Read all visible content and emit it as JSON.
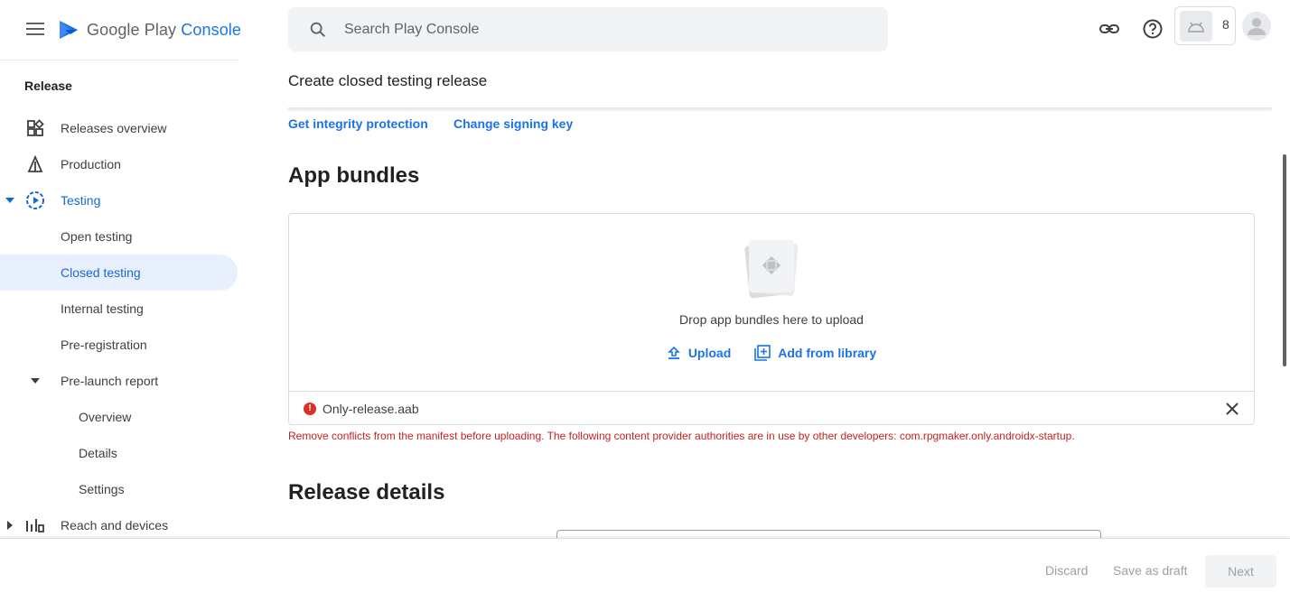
{
  "header": {
    "logo_google": "Google Play",
    "logo_console": "Console",
    "search_placeholder": "Search Play Console",
    "app_count": "8"
  },
  "sidebar": {
    "section": "Release",
    "items": [
      {
        "label": "Releases overview",
        "icon": "dashboard-icon"
      },
      {
        "label": "Production",
        "icon": "production-icon"
      },
      {
        "label": "Testing",
        "icon": "testing-icon"
      },
      {
        "label": "Open testing"
      },
      {
        "label": "Closed testing"
      },
      {
        "label": "Internal testing"
      },
      {
        "label": "Pre-registration"
      },
      {
        "label": "Pre-launch report"
      },
      {
        "label": "Overview"
      },
      {
        "label": "Details"
      },
      {
        "label": "Settings"
      },
      {
        "label": "Reach and devices",
        "icon": "bar-chart-icon"
      }
    ]
  },
  "main": {
    "title": "Create closed testing release",
    "links": [
      "Get integrity protection",
      "Change signing key"
    ],
    "app_bundles_heading": "App bundles",
    "drop_text": "Drop app bundles here to upload",
    "upload_label": "Upload",
    "library_label": "Add from library",
    "file_name": "Only-release.aab",
    "error_text": "Remove conflicts from the manifest before uploading. The following content provider authorities are in use by other developers: com.rpgmaker.only.androidx-startup.",
    "release_details_heading": "Release details"
  },
  "footer": {
    "discard": "Discard",
    "save_draft": "Save as draft",
    "next": "Next"
  },
  "colors": {
    "accent": "#1a73e8",
    "active_bg": "#e8f0fe",
    "error": "#c5221f"
  }
}
